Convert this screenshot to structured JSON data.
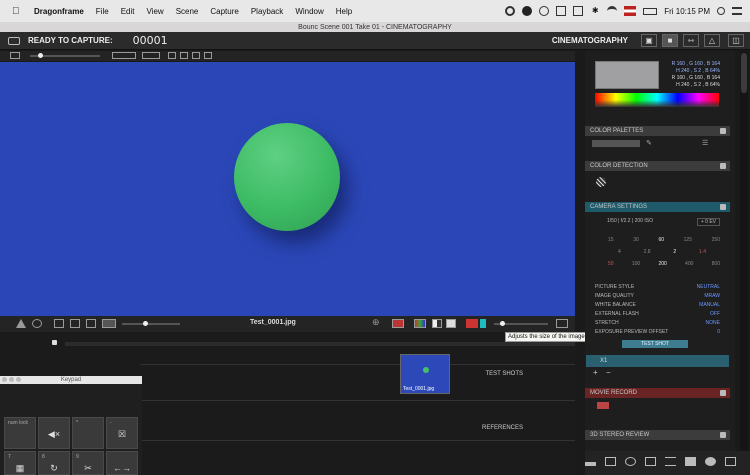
{
  "menubar": {
    "app_name": "Dragonframe",
    "items": [
      "File",
      "Edit",
      "View",
      "Scene",
      "Capture",
      "Playback",
      "Window",
      "Help"
    ],
    "clock": "Fri 10:15 PM"
  },
  "window": {
    "title": "Bounc  Scene 001  Take 01 - CINEMATOGRAPHY"
  },
  "appbar": {
    "status": "READY TO CAPTURE:",
    "frame": "00001",
    "workspace": "CINEMATOGRAPHY"
  },
  "viewer": {
    "filename": "Test_0001.jpg",
    "tooltip": "Adjusts the size of the image.",
    "background_color": "#2b47b7",
    "ball_color": "#48c06a"
  },
  "timeline": {
    "test_shots_label": "TEST SHOTS",
    "references_label": "REFERENCES",
    "thumbnail_label": "Test_0001.jpg"
  },
  "keypad": {
    "title": "Keypad",
    "keys": [
      {
        "label": "num lock",
        "glyph": ""
      },
      {
        "label": "",
        "glyph": "◀×"
      },
      {
        "label": "*",
        "glyph": ""
      },
      {
        "label": "-",
        "glyph": "☒"
      },
      {
        "label": "7",
        "glyph": "▦"
      },
      {
        "label": "8",
        "glyph": "↻"
      },
      {
        "label": "9",
        "glyph": "✂"
      },
      {
        "label": "",
        "glyph": "←→"
      }
    ]
  },
  "color_picker": {
    "rgb1": "R 160 , G 160 , B 164",
    "hsb1": "H 240 , S 2 , B 64%",
    "rgb2": "R 160 , G 160 , B 164",
    "hsb2": "H 240 , S 2 , B 64%"
  },
  "sections": {
    "color_palettes": "COLOR PALETTES",
    "color_detection": "COLOR DETECTION",
    "camera_settings": "CAMERA SETTINGS",
    "movie_record": "MOVIE RECORD",
    "stereo_review": "3D STEREO REVIEW"
  },
  "camera": {
    "summary": "1/50  |  f/2.2  |  200 ISO",
    "ev": "+ 0 EV",
    "shutter_row": [
      "15",
      "30",
      "60",
      "125",
      "250"
    ],
    "aperture_row": [
      "4",
      "2.8",
      "2",
      "1.4"
    ],
    "iso_row": [
      "50",
      "100",
      "200",
      "400",
      "800"
    ],
    "settings": [
      {
        "name": "PICTURE STYLE",
        "value": "NEUTRAL"
      },
      {
        "name": "IMAGE QUALITY",
        "value": "MRAW"
      },
      {
        "name": "WHITE BALANCE",
        "value": "MANUAL"
      },
      {
        "name": "EXTERNAL FLASH",
        "value": "OFF"
      },
      {
        "name": "STRETCH",
        "value": "NONE"
      },
      {
        "name": "EXPOSURE PREVIEW OFFSET",
        "value": "0"
      }
    ],
    "test_shot_label": "TEST SHOT",
    "x1_label": "X1"
  },
  "colors": {
    "accent": "#3e7c92",
    "record": "#6a2424",
    "link_blue": "#6d96ff"
  }
}
